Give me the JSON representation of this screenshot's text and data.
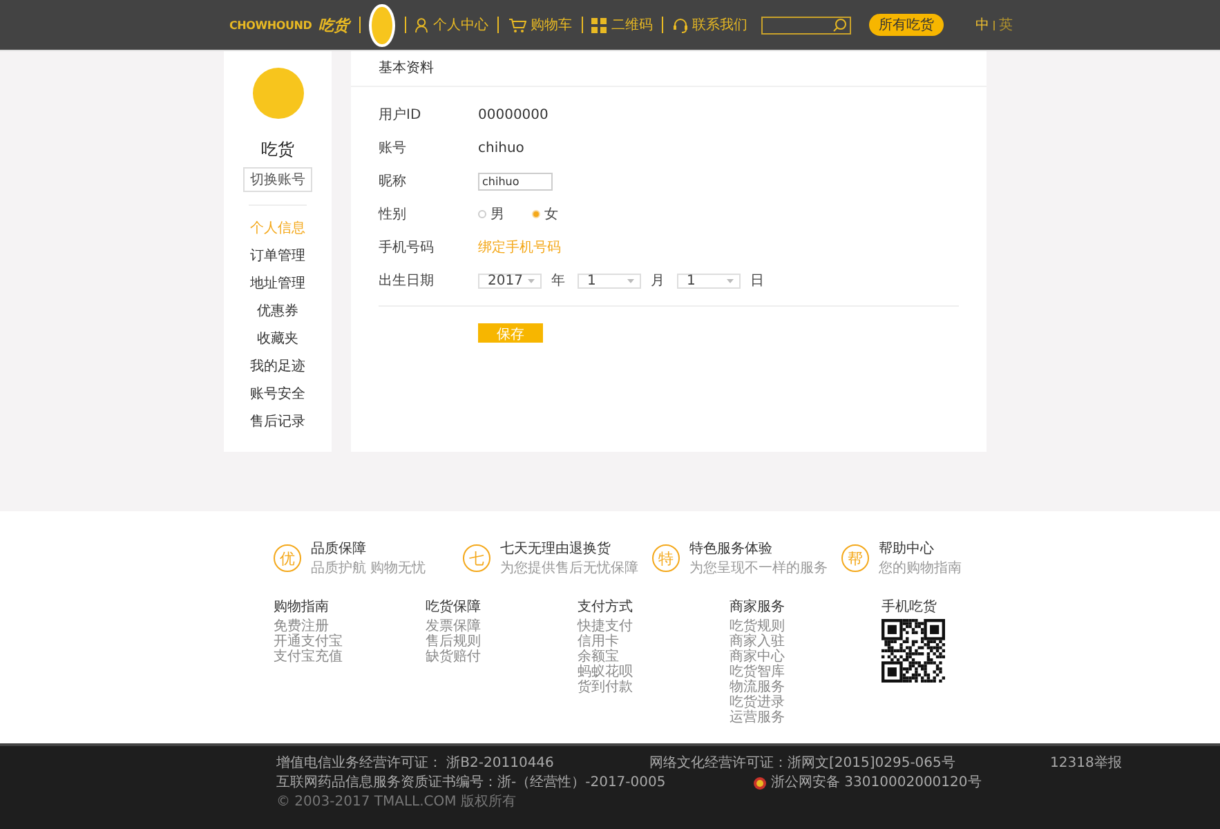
{
  "header": {
    "logo_latin": "CHOWHOUND",
    "logo_cn": "吃货",
    "nav": [
      {
        "label": "个人中心",
        "kind": "person"
      },
      {
        "label": "购物车",
        "kind": "cart"
      },
      {
        "label": "二维码",
        "kind": "grid"
      },
      {
        "label": "联系我们",
        "kind": "headset"
      }
    ],
    "search_button": "所有吃货",
    "languages": [
      {
        "label": "中",
        "selected": true
      },
      {
        "label": "英",
        "selected": false
      }
    ]
  },
  "sidebar": {
    "username": "吃货",
    "switch_button": "切换账号",
    "items": [
      {
        "label": "个人信息",
        "selected": true
      },
      {
        "label": "订单管理",
        "selected": false
      },
      {
        "label": "地址管理",
        "selected": false
      },
      {
        "label": "优惠券",
        "selected": false
      },
      {
        "label": "收藏夹",
        "selected": false
      },
      {
        "label": "我的足迹",
        "selected": false
      },
      {
        "label": "账号安全",
        "selected": false
      },
      {
        "label": "售后记录",
        "selected": false
      }
    ]
  },
  "profile": {
    "title": "基本资料",
    "rows": [
      {
        "kind": "text",
        "label": "用户ID",
        "value": "00000000"
      },
      {
        "kind": "text",
        "label": "账号",
        "value": "chihuo"
      },
      {
        "kind": "input",
        "label": "昵称",
        "value": "chihuo"
      },
      {
        "kind": "radio",
        "label": "性别",
        "options": [
          {
            "label": "男",
            "selected": false
          },
          {
            "label": "女",
            "selected": true
          }
        ]
      },
      {
        "kind": "link",
        "label": "手机号码",
        "value": "绑定手机号码"
      },
      {
        "kind": "date",
        "label": "出生日期",
        "parts": [
          {
            "value": "2017",
            "unit": "年"
          },
          {
            "value": "1",
            "unit": "月"
          },
          {
            "value": "1",
            "unit": "日"
          }
        ]
      }
    ],
    "save_button": "保存"
  },
  "features": [
    {
      "badge": "优",
      "title": "品质保障",
      "subtitle": "品质护航 购物无忧"
    },
    {
      "badge": "七",
      "title": "七天无理由退换货",
      "subtitle": "为您提供售后无忧保障"
    },
    {
      "badge": "特",
      "title": "特色服务体验",
      "subtitle": "为您呈现不一样的服务"
    },
    {
      "badge": "帮",
      "title": "帮助中心",
      "subtitle": "您的购物指南"
    }
  ],
  "footer_columns": [
    {
      "title": "购物指南",
      "links": [
        "免费注册",
        "开通支付宝",
        "支付宝充值"
      ]
    },
    {
      "title": "吃货保障",
      "links": [
        "发票保障",
        "售后规则",
        "缺货赔付"
      ]
    },
    {
      "title": "支付方式",
      "links": [
        "快捷支付",
        "信用卡",
        "余额宝",
        "蚂蚁花呗",
        "货到付款"
      ]
    },
    {
      "title": "商家服务",
      "links": [
        "吃货规则",
        "商家入驻",
        "商家中心",
        "吃货智库",
        "物流服务",
        "吃货进录",
        "运营服务"
      ]
    }
  ],
  "mobile": {
    "title": "手机吃货"
  },
  "legal": {
    "line1": [
      "增值电信业务经营许可证： 浙B2-20110446",
      "网络文化经营许可证：浙网文[2015]0295-065号",
      "12318举报"
    ],
    "line2": [
      "互联网药品信息服务资质证书编号：浙-（经营性）-2017-0005",
      "浙公网安备 33010002000120号"
    ],
    "copyright": "© 2003-2017 TMALL.COM 版权所有"
  }
}
